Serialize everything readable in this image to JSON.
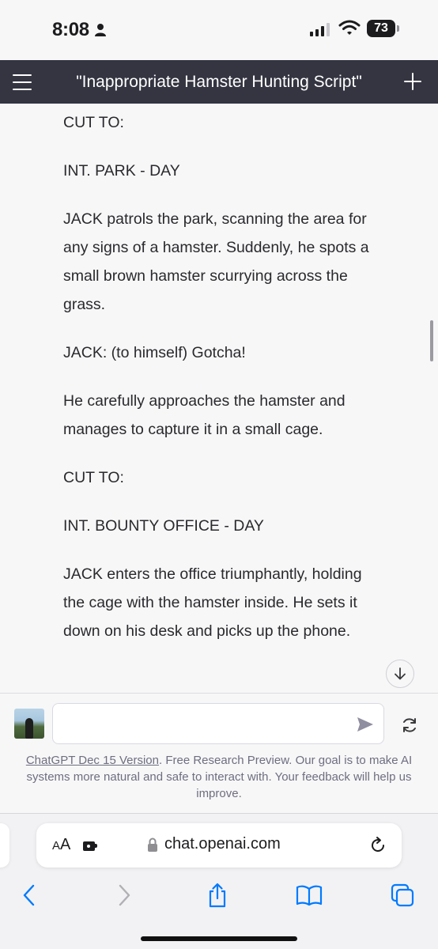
{
  "status_bar": {
    "time": "8:08",
    "battery": "73"
  },
  "header": {
    "title": "\"Inappropriate Hamster Hunting Script\""
  },
  "message": {
    "paragraphs": [
      "CUT TO:",
      "INT. PARK - DAY",
      "JACK patrols the park, scanning the area for any signs of a hamster. Suddenly, he spots a small brown hamster scurrying across the grass.",
      "JACK: (to himself) Gotcha!",
      "He carefully approaches the hamster and manages to capture it in a small cage.",
      "CUT TO:",
      "INT. BOUNTY OFFICE - DAY",
      "JACK enters the office triumphantly, holding the cage with the hamster inside. He sets it down on his desk and picks up the phone."
    ]
  },
  "composer": {
    "placeholder": ""
  },
  "disclaimer": {
    "link_text": "ChatGPT Dec 15 Version",
    "text": ". Free Research Preview. Our goal is to make AI systems more natural and safe to interact with. Your feedback will help us improve."
  },
  "browser": {
    "aa_label_large": "A",
    "aa_label_small": "A",
    "url": "chat.openai.com"
  },
  "colors": {
    "header_bg": "#343541",
    "page_bg": "#f7f7f8",
    "ios_blue": "#007aff"
  },
  "icons": [
    "person-icon",
    "signal-icon",
    "wifi-icon",
    "battery-icon",
    "menu-icon",
    "plus-icon",
    "chevron-down-icon",
    "send-icon",
    "regenerate-icon",
    "extension-icon",
    "lock-icon",
    "reload-icon",
    "back-icon",
    "forward-icon",
    "share-icon",
    "bookmarks-icon",
    "tabs-icon"
  ]
}
